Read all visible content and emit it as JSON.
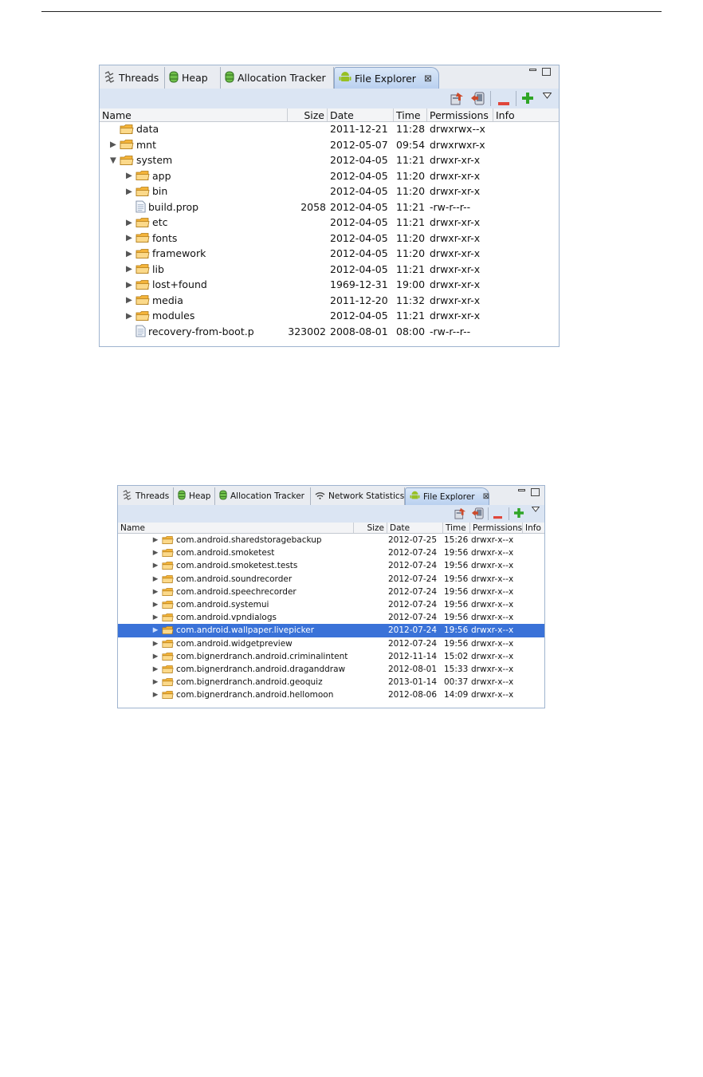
{
  "panel1": {
    "tabs": [
      {
        "label": "Threads",
        "icon": "threads-icon"
      },
      {
        "label": "Heap",
        "icon": "heap-icon"
      },
      {
        "label": "Allocation Tracker",
        "icon": "heap-icon"
      },
      {
        "label": "File Explorer",
        "icon": "android-icon",
        "active": true
      }
    ],
    "columns": {
      "name": "Name",
      "size": "Size",
      "date": "Date",
      "time": "Time",
      "permissions": "Permissions",
      "info": "Info"
    },
    "rows": [
      {
        "name": "data",
        "type": "folder",
        "expander": "",
        "indent": 0,
        "size": "",
        "date": "2011-12-21",
        "time": "11:28",
        "perms": "drwxrwx--x"
      },
      {
        "name": "mnt",
        "type": "folder",
        "expander": "▶",
        "indent": 0,
        "size": "",
        "date": "2012-05-07",
        "time": "09:54",
        "perms": "drwxrwxr-x"
      },
      {
        "name": "system",
        "type": "folder",
        "expander": "▼",
        "indent": 0,
        "size": "",
        "date": "2012-04-05",
        "time": "11:21",
        "perms": "drwxr-xr-x"
      },
      {
        "name": "app",
        "type": "folder",
        "expander": "▶",
        "indent": 1,
        "size": "",
        "date": "2012-04-05",
        "time": "11:20",
        "perms": "drwxr-xr-x"
      },
      {
        "name": "bin",
        "type": "folder",
        "expander": "▶",
        "indent": 1,
        "size": "",
        "date": "2012-04-05",
        "time": "11:20",
        "perms": "drwxr-xr-x"
      },
      {
        "name": "build.prop",
        "type": "file",
        "expander": "",
        "indent": 1,
        "size": "2058",
        "date": "2012-04-05",
        "time": "11:21",
        "perms": "-rw-r--r--"
      },
      {
        "name": "etc",
        "type": "folder",
        "expander": "▶",
        "indent": 1,
        "size": "",
        "date": "2012-04-05",
        "time": "11:21",
        "perms": "drwxr-xr-x"
      },
      {
        "name": "fonts",
        "type": "folder",
        "expander": "▶",
        "indent": 1,
        "size": "",
        "date": "2012-04-05",
        "time": "11:20",
        "perms": "drwxr-xr-x"
      },
      {
        "name": "framework",
        "type": "folder",
        "expander": "▶",
        "indent": 1,
        "size": "",
        "date": "2012-04-05",
        "time": "11:20",
        "perms": "drwxr-xr-x"
      },
      {
        "name": "lib",
        "type": "folder",
        "expander": "▶",
        "indent": 1,
        "size": "",
        "date": "2012-04-05",
        "time": "11:21",
        "perms": "drwxr-xr-x"
      },
      {
        "name": "lost+found",
        "type": "folder",
        "expander": "▶",
        "indent": 1,
        "size": "",
        "date": "1969-12-31",
        "time": "19:00",
        "perms": "drwxr-xr-x"
      },
      {
        "name": "media",
        "type": "folder",
        "expander": "▶",
        "indent": 1,
        "size": "",
        "date": "2011-12-20",
        "time": "11:32",
        "perms": "drwxr-xr-x"
      },
      {
        "name": "modules",
        "type": "folder",
        "expander": "▶",
        "indent": 1,
        "size": "",
        "date": "2012-04-05",
        "time": "11:21",
        "perms": "drwxr-xr-x"
      },
      {
        "name": "recovery-from-boot.p",
        "type": "file",
        "expander": "",
        "indent": 1,
        "size": "323002",
        "date": "2008-08-01",
        "time": "08:00",
        "perms": "-rw-r--r--"
      }
    ]
  },
  "panel2": {
    "tabs": [
      {
        "label": "Threads",
        "icon": "threads-icon"
      },
      {
        "label": "Heap",
        "icon": "heap-icon"
      },
      {
        "label": "Allocation Tracker",
        "icon": "heap-icon"
      },
      {
        "label": "Network Statistics",
        "icon": "wifi-icon"
      },
      {
        "label": "File Explorer",
        "icon": "android-icon",
        "active": true
      }
    ],
    "columns": {
      "name": "Name",
      "size": "Size",
      "date": "Date",
      "time": "Time",
      "permissions": "Permissions",
      "info": "Info"
    },
    "rows": [
      {
        "name": "com.android.sharedstoragebackup",
        "type": "folder",
        "expander": "▶",
        "indent": 2,
        "size": "",
        "date": "2012-07-25",
        "time": "15:26",
        "perms": "drwxr-x--x"
      },
      {
        "name": "com.android.smoketest",
        "type": "folder",
        "expander": "▶",
        "indent": 2,
        "size": "",
        "date": "2012-07-24",
        "time": "19:56",
        "perms": "drwxr-x--x"
      },
      {
        "name": "com.android.smoketest.tests",
        "type": "folder",
        "expander": "▶",
        "indent": 2,
        "size": "",
        "date": "2012-07-24",
        "time": "19:56",
        "perms": "drwxr-x--x"
      },
      {
        "name": "com.android.soundrecorder",
        "type": "folder",
        "expander": "▶",
        "indent": 2,
        "size": "",
        "date": "2012-07-24",
        "time": "19:56",
        "perms": "drwxr-x--x"
      },
      {
        "name": "com.android.speechrecorder",
        "type": "folder",
        "expander": "▶",
        "indent": 2,
        "size": "",
        "date": "2012-07-24",
        "time": "19:56",
        "perms": "drwxr-x--x"
      },
      {
        "name": "com.android.systemui",
        "type": "folder",
        "expander": "▶",
        "indent": 2,
        "size": "",
        "date": "2012-07-24",
        "time": "19:56",
        "perms": "drwxr-x--x"
      },
      {
        "name": "com.android.vpndialogs",
        "type": "folder",
        "expander": "▶",
        "indent": 2,
        "size": "",
        "date": "2012-07-24",
        "time": "19:56",
        "perms": "drwxr-x--x"
      },
      {
        "name": "com.android.wallpaper.livepicker",
        "type": "folder",
        "expander": "▶",
        "indent": 2,
        "size": "",
        "date": "2012-07-24",
        "time": "19:56",
        "perms": "drwxr-x--x",
        "selected": true
      },
      {
        "name": "com.android.widgetpreview",
        "type": "folder",
        "expander": "▶",
        "indent": 2,
        "size": "",
        "date": "2012-07-24",
        "time": "19:56",
        "perms": "drwxr-x--x"
      },
      {
        "name": "com.bignerdranch.android.criminalintent",
        "type": "folder",
        "expander": "▶",
        "indent": 2,
        "size": "",
        "date": "2012-11-14",
        "time": "15:02",
        "perms": "drwxr-x--x"
      },
      {
        "name": "com.bignerdranch.android.draganddraw",
        "type": "folder",
        "expander": "▶",
        "indent": 2,
        "size": "",
        "date": "2012-08-01",
        "time": "15:33",
        "perms": "drwxr-x--x"
      },
      {
        "name": "com.bignerdranch.android.geoquiz",
        "type": "folder",
        "expander": "▶",
        "indent": 2,
        "size": "",
        "date": "2013-01-14",
        "time": "00:37",
        "perms": "drwxr-x--x"
      },
      {
        "name": "com.bignerdranch.android.hellomoon",
        "type": "folder",
        "expander": "▶",
        "indent": 2,
        "size": "",
        "date": "2012-08-06",
        "time": "14:09",
        "perms": "drwxr-x--x"
      }
    ]
  },
  "colors": {
    "selection": "#3a72d8",
    "folder": "#f6c35a",
    "remove": "#e0453a",
    "add": "#2fa526",
    "android": "#97c024"
  }
}
